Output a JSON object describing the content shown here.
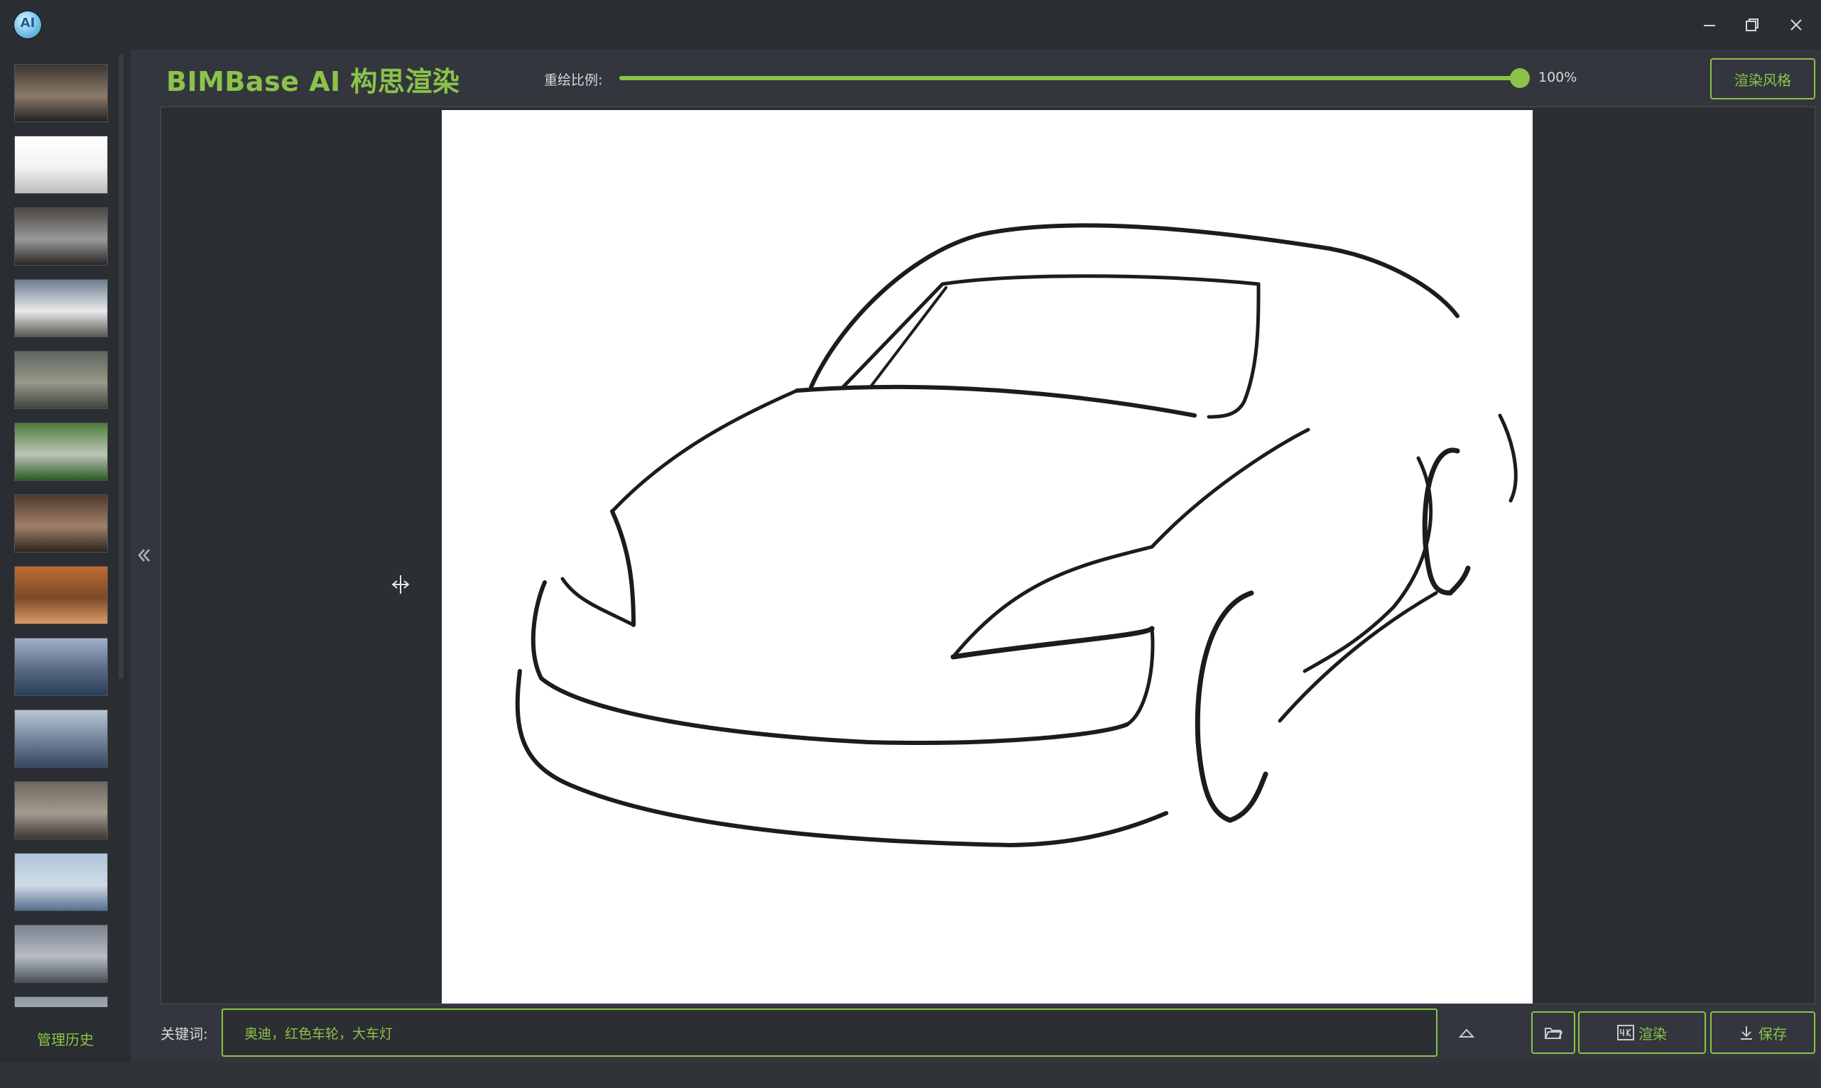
{
  "window": {
    "logo_text": "AI",
    "controls": [
      "minimize-icon",
      "restore-icon",
      "close-icon"
    ]
  },
  "header": {
    "title": "BIMBase AI 构思渲染",
    "ratio_label": "重绘比例:",
    "ratio_value": "100%",
    "ratio_level": 1.0,
    "style_button": "渲染风格"
  },
  "sidebar": {
    "manage_history": "管理历史",
    "thumbnails": [
      {
        "subject": "dark sports car",
        "colors": [
          "#3b3632",
          "#8b7a6a",
          "#222"
        ]
      },
      {
        "subject": "car line sketch",
        "colors": [
          "#ffffff",
          "#f2f2f2",
          "#bbbbbb"
        ]
      },
      {
        "subject": "silver car",
        "colors": [
          "#4a4744",
          "#9a9a9c",
          "#2a2826"
        ]
      },
      {
        "subject": "white car",
        "colors": [
          "#6f7e92",
          "#e8e9ea",
          "#5a5852"
        ]
      },
      {
        "subject": "aerial town",
        "colors": [
          "#5e6660",
          "#9a9888",
          "#3d443f"
        ]
      },
      {
        "subject": "village green",
        "colors": [
          "#4e7d3b",
          "#bcc5b8",
          "#2d5b24"
        ]
      },
      {
        "subject": "wooden house",
        "colors": [
          "#4f3a2b",
          "#a08068",
          "#2d2520"
        ]
      },
      {
        "subject": "clay house",
        "colors": [
          "#bf6c2f",
          "#7b4a2a",
          "#d89a60"
        ]
      },
      {
        "subject": "city skyline",
        "colors": [
          "#9fb2c8",
          "#586a84",
          "#2b3e58"
        ]
      },
      {
        "subject": "city waterfront",
        "colors": [
          "#b9c7d6",
          "#6e7f96",
          "#354962"
        ]
      },
      {
        "subject": "dusk city",
        "colors": [
          "#706860",
          "#a49a8e",
          "#3d3833"
        ]
      },
      {
        "subject": "river city",
        "colors": [
          "#aec3dc",
          "#d0dbe6",
          "#56708e"
        ]
      },
      {
        "subject": "grey city",
        "colors": [
          "#7d8490",
          "#b7bcc4",
          "#4a5058"
        ]
      },
      {
        "subject": "city partial",
        "colors": [
          "#8f98a4",
          "#c4c8ce",
          "#5a626c"
        ]
      }
    ]
  },
  "canvas": {
    "icons": [
      "collapse-left-icon",
      "resize-cursor-icon"
    ]
  },
  "footer": {
    "keyword_label": "关键词:",
    "keyword_value": "奥迪，红色车轮，大车灯",
    "render_button": "渲染",
    "save_button": "保存",
    "icons": [
      "expand-up-icon",
      "folder-icon",
      "4k-icon",
      "download-icon"
    ]
  }
}
